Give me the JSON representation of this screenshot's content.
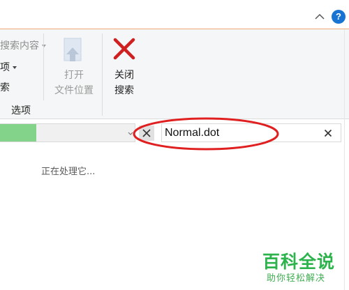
{
  "ribbon": {
    "search_content_label": "搜索内容",
    "options_partial_label": "项",
    "search_partial_label": "索",
    "group_label": "选项",
    "open_file_location_line1": "打开",
    "open_file_location_line2": "文件位置",
    "close_search_line1": "关闭",
    "close_search_line2": "搜索"
  },
  "address_bar": {
    "progress": 0.27
  },
  "search": {
    "value": "Normal.dot"
  },
  "status": {
    "text": "正在处理它..."
  },
  "watermark": {
    "title": "百科全说",
    "subtitle": "助你轻松解决"
  },
  "icons": {
    "help": "help-icon",
    "collapse": "chevron-up-icon",
    "close_search": "red-x-icon",
    "open_location": "folder-arrow-icon",
    "stop": "close-icon",
    "clear_search": "close-icon"
  },
  "colors": {
    "accent_line": "#f0a776",
    "progress_fill": "#84d38a",
    "help_blue": "#1874d2",
    "annotation_red": "#e02020",
    "watermark_green": "#2db34b"
  }
}
